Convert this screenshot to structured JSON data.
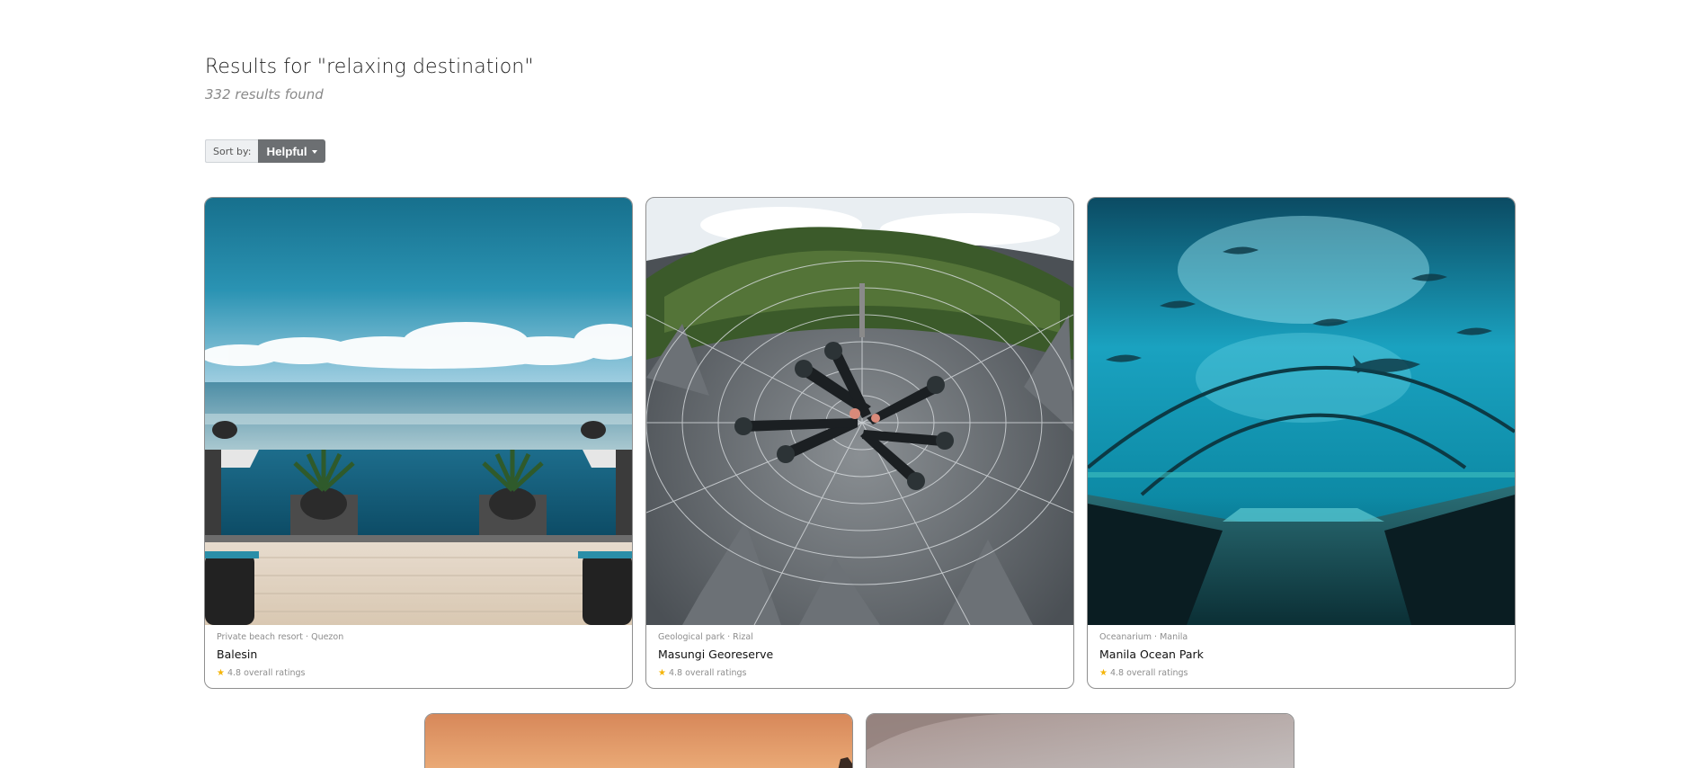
{
  "search": {
    "title": "Results for \"relaxing destination\"",
    "count_label": "332 results found"
  },
  "sort": {
    "label": "Sort by:",
    "selected": "Helpful"
  },
  "cards": [
    {
      "category": "Private beach resort · Quezon",
      "name": "Balesin",
      "rating": "4.8 overall ratings",
      "image": "infinity-pool-ocean-view"
    },
    {
      "category": "Geological park · Rizal",
      "name": "Masungi Georeserve",
      "rating": "4.8 overall ratings",
      "image": "spider-web-net-rock-formations"
    },
    {
      "category": "Oceanarium · Manila",
      "name": "Manila Ocean Park",
      "rating": "4.8 overall ratings",
      "image": "underwater-aquarium-tunnel"
    },
    {
      "image": "sunset-sky"
    },
    {
      "image": "hazy-sky"
    }
  ],
  "icons": {
    "star": "star-icon",
    "caret": "caret-down-icon"
  },
  "colors": {
    "star": "#f5b50a",
    "sort_button": "#6c6f72"
  }
}
